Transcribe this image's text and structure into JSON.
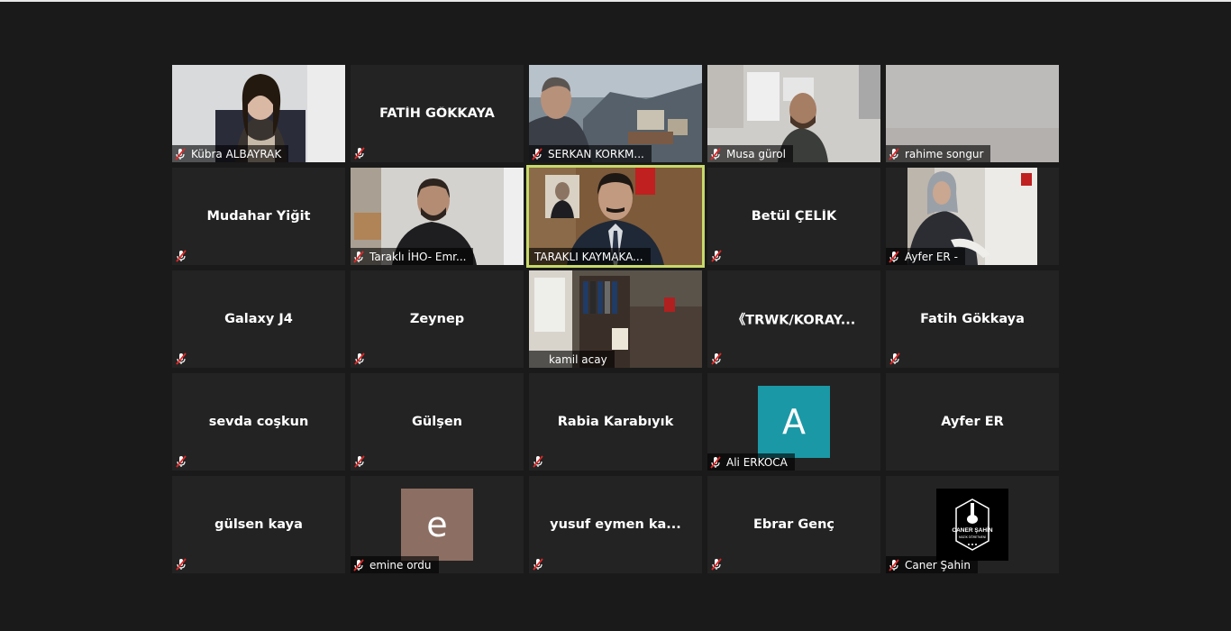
{
  "participants": [
    {
      "name": "Kübra ALBAYRAK",
      "type": "video"
    },
    {
      "name": "FATİH GÖKKAYA",
      "type": "name"
    },
    {
      "name": "SERKAN KORKM...",
      "type": "video"
    },
    {
      "name": "Musa gürol",
      "type": "video"
    },
    {
      "name": "rahime songur",
      "type": "video"
    },
    {
      "name": "Mudahar Yiğit",
      "type": "name"
    },
    {
      "name": "Taraklı İHO- Emr...",
      "type": "video"
    },
    {
      "name": "TARAKLI KAYMAKA...",
      "type": "video",
      "active": true
    },
    {
      "name": "Betül ÇELİK",
      "type": "name"
    },
    {
      "name": "Ayfer ER -",
      "type": "video"
    },
    {
      "name": "Galaxy J4",
      "type": "name"
    },
    {
      "name": "Zeynep",
      "type": "name"
    },
    {
      "name": "kamil acay",
      "type": "video"
    },
    {
      "name": "《TRWK/KORAY...",
      "type": "name"
    },
    {
      "name": "Fatih Gökkaya",
      "type": "name"
    },
    {
      "name": "sevda coşkun",
      "type": "name"
    },
    {
      "name": "Gülşen",
      "type": "name"
    },
    {
      "name": "Rabia Karabıyık",
      "type": "name"
    },
    {
      "name": "Ali ERKOCA",
      "type": "avatar",
      "initial": "A",
      "color": "#1b98a6"
    },
    {
      "name": "Ayfer ER",
      "type": "name"
    },
    {
      "name": "gülsen kaya",
      "type": "name"
    },
    {
      "name": "emine ordu",
      "type": "avatar",
      "initial": "e",
      "color": "#8d6e63"
    },
    {
      "name": "yusuf eymen ka...",
      "type": "name"
    },
    {
      "name": "Ebrar Genç",
      "type": "name"
    },
    {
      "name": "Caner Şahin",
      "type": "logo",
      "logo_text": "CANER ŞAHİN",
      "logo_sub": "MÜZİK ÖĞRETMENİ"
    }
  ],
  "colors": {
    "background": "#1a1a1a",
    "tile": "#232323",
    "active_border": "#c7d96a",
    "muted_icon": "#e02828"
  },
  "icons": {
    "muted": "mic-muted-icon"
  }
}
